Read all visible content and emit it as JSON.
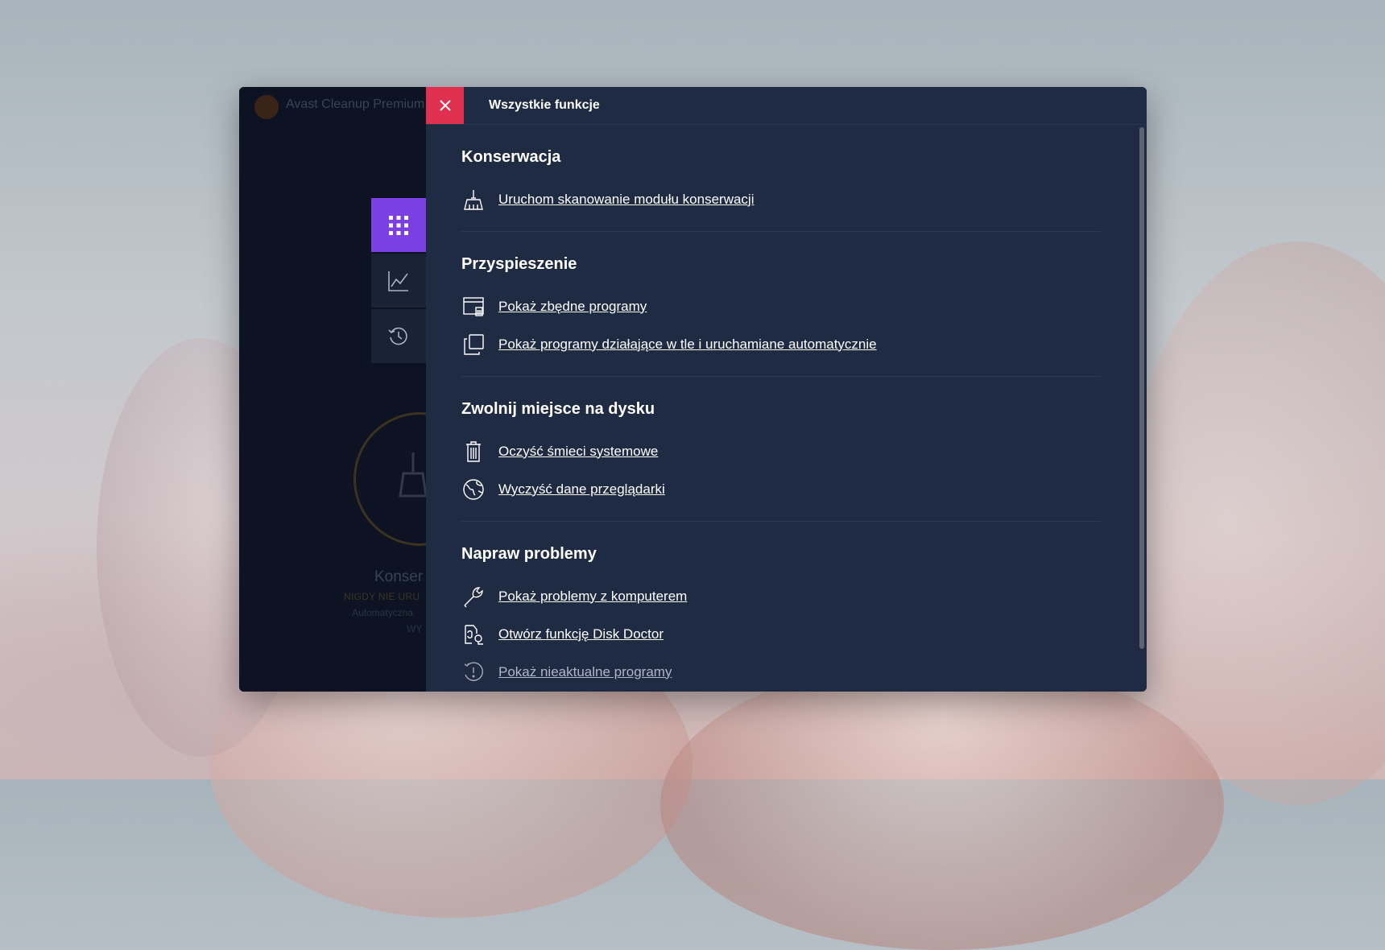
{
  "background_app": {
    "title": "Avast Cleanup Premium",
    "tabs": [
      {
        "icon": "apps-grid-icon"
      },
      {
        "icon": "chart-icon"
      },
      {
        "icon": "history-icon"
      }
    ],
    "status_title": "Konser",
    "status_line": "NIGDY NIE URU",
    "status_sub": "Automatyczna",
    "status_sub2": "WY"
  },
  "panel": {
    "title": "Wszystkie funkcje",
    "close_icon": "close-icon",
    "sections": [
      {
        "title": "Konserwacja",
        "items": [
          {
            "label": "Uruchom skanowanie modułu konserwacji",
            "icon": "broom-icon"
          }
        ]
      },
      {
        "title": "Przyspieszenie",
        "items": [
          {
            "label": "Pokaż zbędne programy",
            "icon": "unneeded-programs-icon"
          },
          {
            "label": "Pokaż programy działające w tle i uruchamiane automatycznie",
            "icon": "background-programs-icon"
          }
        ]
      },
      {
        "title": "Zwolnij miejsce na dysku",
        "items": [
          {
            "label": "Oczyść śmieci systemowe",
            "icon": "trash-icon"
          },
          {
            "label": "Wyczyść dane przeglądarki",
            "icon": "browser-globe-icon"
          }
        ]
      },
      {
        "title": "Napraw problemy",
        "items": [
          {
            "label": "Pokaż problemy z komputerem",
            "icon": "wrench-icon"
          },
          {
            "label": "Otwórz funkcję Disk Doctor",
            "icon": "disk-doctor-icon"
          },
          {
            "label": "Pokaż nieaktualne programy",
            "icon": "outdated-programs-icon"
          }
        ]
      }
    ]
  },
  "colors": {
    "accent_purple": "#7b3fe4",
    "close_red": "#e0304f",
    "panel_bg": "#1f2a43"
  }
}
